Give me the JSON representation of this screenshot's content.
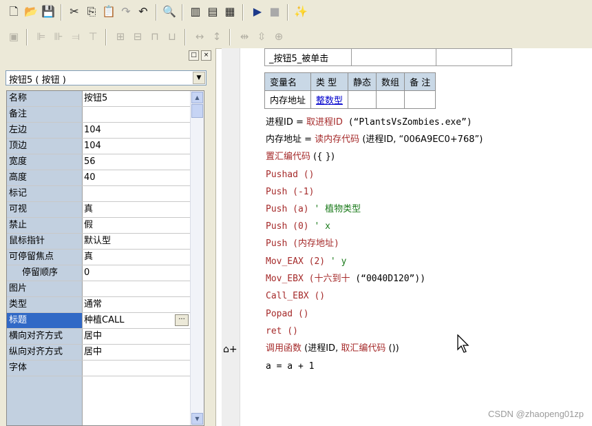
{
  "toolbar_main": {
    "buttons": [
      "new-icon",
      "open-icon",
      "save-icon",
      "cut-icon",
      "copy-icon",
      "paste-icon",
      "redo-icon",
      "undo-icon",
      "find-icon",
      "layout-left-icon",
      "layout-top-icon",
      "layout-grid-icon",
      "run-icon",
      "stop-icon",
      "wizard-icon"
    ]
  },
  "toolbar_align": {
    "buttons": [
      "align-grid-icon",
      "align-left-icon",
      "align-center-h-icon",
      "align-right-icon",
      "align-top-icon",
      "align-middle-icon",
      "align-bottom-icon",
      "same-width-icon",
      "same-height-icon",
      "same-size-icon",
      "space-h-icon",
      "space-v-icon",
      "center-form-h-icon",
      "center-form-v-icon",
      "center-form-icon"
    ]
  },
  "left_pane": {
    "caption_buttons": [
      "□",
      "×"
    ],
    "object_select": "按钮5 ( 按钮 )",
    "properties": [
      {
        "name": "名称",
        "value": "按钮5"
      },
      {
        "name": "备注",
        "value": ""
      },
      {
        "name": "左边",
        "value": "104"
      },
      {
        "name": "顶边",
        "value": "104"
      },
      {
        "name": "宽度",
        "value": "56"
      },
      {
        "name": "高度",
        "value": "40"
      },
      {
        "name": "标记",
        "value": ""
      },
      {
        "name": "可视",
        "value": "真"
      },
      {
        "name": "禁止",
        "value": "假"
      },
      {
        "name": "鼠标指针",
        "value": "默认型"
      },
      {
        "name": "可停留焦点",
        "value": "真"
      },
      {
        "name": "停留顺序",
        "value": "0"
      },
      {
        "name": "图片",
        "value": ""
      },
      {
        "name": "类型",
        "value": "通常"
      },
      {
        "name": "标题",
        "value": "种植CALL"
      },
      {
        "name": "横向对齐方式",
        "value": "居中"
      },
      {
        "name": "纵向对齐方式",
        "value": "居中"
      },
      {
        "name": "字体",
        "value": ""
      }
    ],
    "ellipsis_label": "···"
  },
  "code": {
    "sub_name": "_按钮5_被单击",
    "var_headers": [
      "变量名",
      "类 型",
      "静态",
      "数组",
      "备 注"
    ],
    "var_row": {
      "name": "内存地址",
      "type": "整数型",
      "static": "",
      "array": "",
      "note": ""
    },
    "lines": {
      "l1_a": "进程ID = ",
      "l1_b": "取进程ID",
      "l1_c": " (“PlantsVsZombies.exe”)",
      "l2_a": "内存地址 = ",
      "l2_b": "读内存代码",
      "l2_c": " (进程ID, “006A9EC0+768”)",
      "l3_a": "置汇编代码",
      "l3_b": " ({ })",
      "l4": "Pushad ()",
      "l5": "Push (-1)",
      "l6_a": "Push (a)  ",
      "l6_b": "' 植物类型",
      "l7_a": "Push (0)  ",
      "l7_b": "' x",
      "l8": "Push (内存地址)",
      "l9_a": "Mov_EAX (2)  ",
      "l9_b": "' y",
      "l10_a": "Mov_EBX (",
      "l10_b": "十六到十",
      "l10_c": " (“0040D120”))",
      "l11": "Call_EBX ()",
      "l12": "Popad ()",
      "l13": "ret ()",
      "l14_a": "调用函数",
      "l14_b": " (进程ID, ",
      "l14_c": "取汇编代码",
      "l14_d": " ())",
      "l15": "a = a + 1"
    },
    "gutter_mark": "⌂+"
  },
  "watermark": "CSDN @zhaopeng01zp"
}
